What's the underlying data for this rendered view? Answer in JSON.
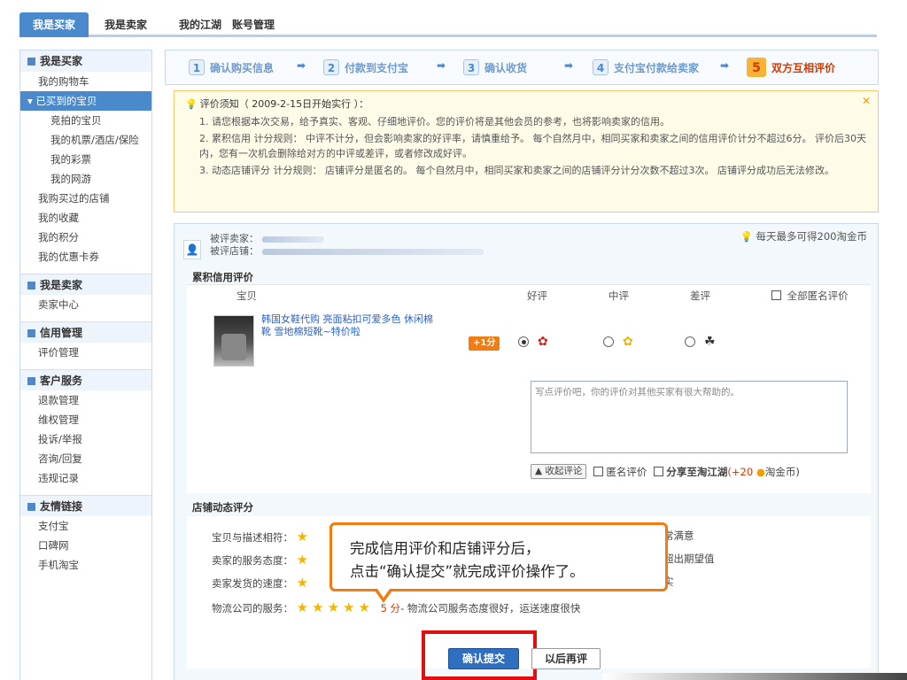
{
  "topnav": {
    "tabs": [
      "我是买家",
      "我是卖家",
      "我的江湖",
      "账号管理"
    ]
  },
  "sidebar": {
    "sections": [
      {
        "title": "我是买家",
        "items": [
          "我的购物车",
          "已买到的宝贝",
          "竞拍的宝贝",
          "我的机票/酒店/保险",
          "我的彩票",
          "我的网游",
          "我购买过的店铺",
          "我的收藏",
          "我的积分",
          "我的优惠卡券"
        ]
      },
      {
        "title": "我是卖家",
        "items": [
          "卖家中心"
        ]
      },
      {
        "title": "信用管理",
        "items": [
          "评价管理"
        ]
      },
      {
        "title": "客户服务",
        "items": [
          "退款管理",
          "维权管理",
          "投诉/举报",
          "咨询/回复",
          "违规记录"
        ]
      },
      {
        "title": "友情链接",
        "items": [
          "支付宝",
          "口碑网",
          "手机淘宝"
        ]
      }
    ]
  },
  "steps": [
    {
      "num": "1",
      "label": "确认购买信息"
    },
    {
      "num": "2",
      "label": "付款到支付宝"
    },
    {
      "num": "3",
      "label": "确认收货"
    },
    {
      "num": "4",
      "label": "支付宝付款给卖家"
    },
    {
      "num": "5",
      "label": "双方互相评价"
    }
  ],
  "notice": {
    "title": "评价须知（ 2009-2-15日开始实行 ）：",
    "items": [
      "1.  请您根据本次交易，给予真实、客观、仔细地评价。您的评价将是其他会员的参考，也将影响卖家的信用。",
      "2.  累积信用 计分规则： 中评不计分，但会影响卖家的好评率，请慎重给予。  每个自然月中，相同买家和卖家之间的信用评价计分不超过6分。  评价后30天内，您有一次机会删除给对方的中评或差评，或者修改成好评。",
      "3.  动态店铺评分 计分规则： 店铺评分是匿名的。  每个自然月中，相同买家和卖家之间的店铺评分计分次数不超过3次。  店铺评分成功后无法修改。"
    ]
  },
  "seller": {
    "label1": "被评卖家：",
    "label2": "被评店铺：",
    "daily": "每天最多可得200淘金币"
  },
  "credit": {
    "title": "累积信用评价",
    "col_item": "宝贝",
    "col_good": "好评",
    "col_mid": "中评",
    "col_bad": "差评",
    "anon_all": "全部匿名评价",
    "product": "韩国女鞋代购 亮面粘扣可爱多色 休闲棉靴 雪地棉短靴~特价啦",
    "plus": "+1分",
    "placeholder": "写点评价吧，你的评价对其他买家有很大帮助的。",
    "collapse": "▲ 收起评论",
    "anon": "匿名评价",
    "share": "分享至淘江湖",
    "share_bonus": "(+20",
    "share_unit": "淘金币)"
  },
  "shop": {
    "title": "店铺动态评分",
    "rows": [
      {
        "label": "宝贝与描述相符：",
        "tail": "常满意"
      },
      {
        "label": "卖家的服务态度：",
        "tail": "超出期望值"
      },
      {
        "label": "卖家发货的速度：",
        "tail": "实"
      },
      {
        "label": "物流公司的服务：",
        "score": "5 分",
        "desc": "- 物流公司服务态度很好，运送速度很快"
      }
    ]
  },
  "tooltip": {
    "line1": "完成信用评价和店铺评分后，",
    "line2": "点击“确认提交”就完成评价操作了。"
  },
  "actions": {
    "submit": "确认提交",
    "later": "以后再评"
  }
}
